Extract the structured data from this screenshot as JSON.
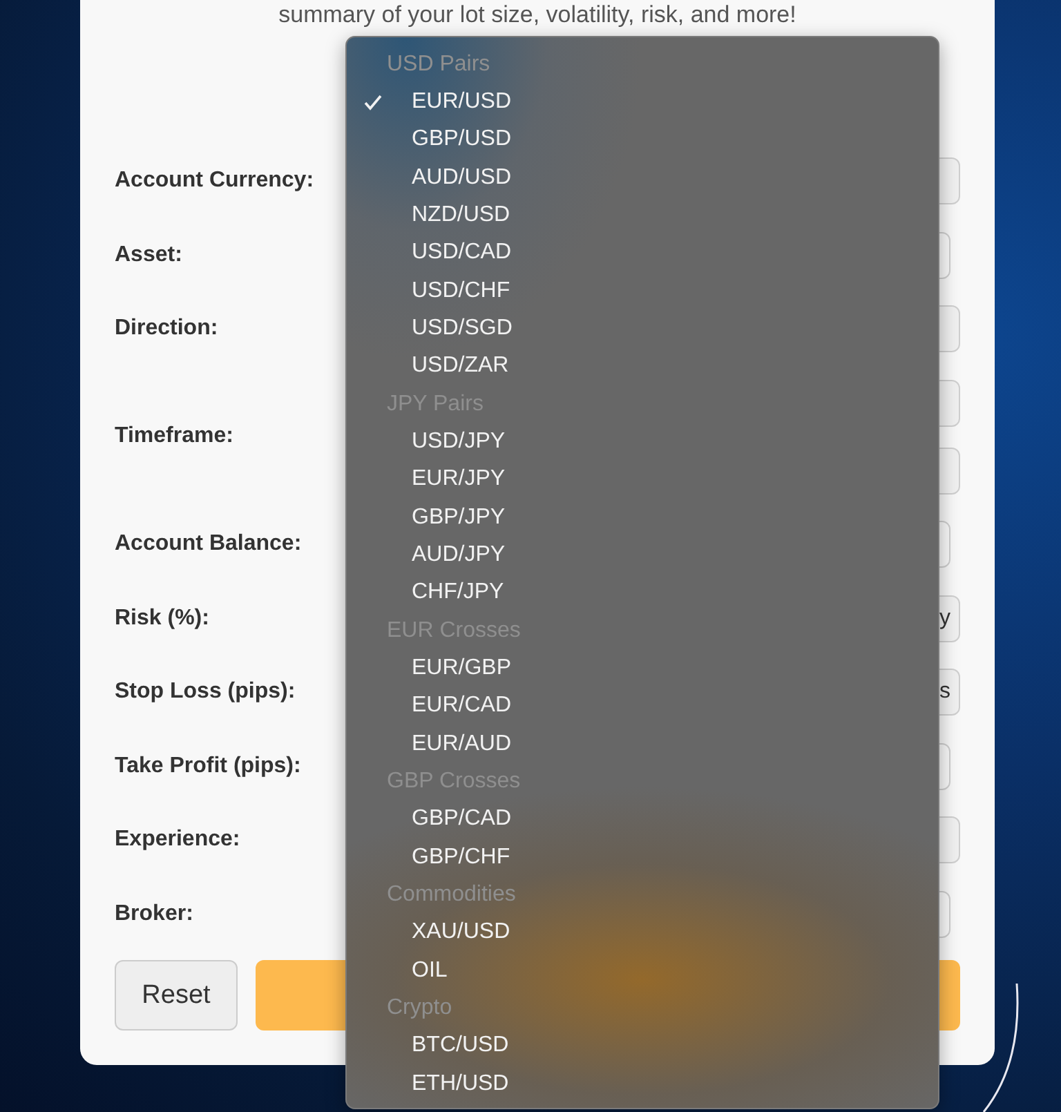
{
  "intro": "summary of your lot size, volatility, risk, and more!",
  "form": {
    "rows": [
      {
        "label": "Account Currency:",
        "fields": [
          {
            "kind": "select"
          }
        ]
      },
      {
        "label": "Asset:",
        "fields": [
          {
            "kind": "input"
          }
        ]
      },
      {
        "label": "Direction:",
        "fields": [
          {
            "kind": "select"
          }
        ]
      },
      {
        "label": "Timeframe:",
        "fields": [
          {
            "kind": "select"
          },
          {
            "kind": "select"
          }
        ]
      },
      {
        "label": "Account Balance:",
        "fields": [
          {
            "kind": "input"
          }
        ]
      },
      {
        "label": "Risk (%):",
        "fields": [
          {
            "kind": "select",
            "value": "y"
          }
        ]
      },
      {
        "label": "Stop Loss (pips):",
        "fields": [
          {
            "kind": "select",
            "value": "s"
          }
        ]
      },
      {
        "label": "Take Profit (pips):",
        "fields": [
          {
            "kind": "input"
          }
        ]
      },
      {
        "label": "Experience:",
        "fields": [
          {
            "kind": "select"
          }
        ]
      },
      {
        "label": "Broker:",
        "fields": [
          {
            "kind": "input"
          }
        ]
      }
    ]
  },
  "buttons": [
    {
      "kind": "secondary",
      "label": "Reset"
    },
    {
      "kind": "primary"
    }
  ],
  "dropdown": {
    "groups": [
      {
        "header": "USD Pairs",
        "options": [
          {
            "label": "EUR/USD",
            "selected": true
          },
          {
            "label": "GBP/USD",
            "selected": false
          },
          {
            "label": "AUD/USD",
            "selected": false
          },
          {
            "label": "NZD/USD",
            "selected": false
          },
          {
            "label": "USD/CAD",
            "selected": false
          },
          {
            "label": "USD/CHF",
            "selected": false
          },
          {
            "label": "USD/SGD",
            "selected": false
          },
          {
            "label": "USD/ZAR",
            "selected": false
          }
        ]
      },
      {
        "header": "JPY Pairs",
        "options": [
          {
            "label": "USD/JPY",
            "selected": false
          },
          {
            "label": "EUR/JPY",
            "selected": false
          },
          {
            "label": "GBP/JPY",
            "selected": false
          },
          {
            "label": "AUD/JPY",
            "selected": false
          },
          {
            "label": "CHF/JPY",
            "selected": false
          }
        ]
      },
      {
        "header": "EUR Crosses",
        "options": [
          {
            "label": "EUR/GBP",
            "selected": false
          },
          {
            "label": "EUR/CAD",
            "selected": false
          },
          {
            "label": "EUR/AUD",
            "selected": false
          }
        ]
      },
      {
        "header": "GBP Crosses",
        "options": [
          {
            "label": "GBP/CAD",
            "selected": false
          },
          {
            "label": "GBP/CHF",
            "selected": false
          }
        ]
      },
      {
        "header": "Commodities",
        "options": [
          {
            "label": "XAU/USD",
            "selected": false
          },
          {
            "label": "OIL",
            "selected": false
          }
        ]
      },
      {
        "header": "Crypto",
        "options": [
          {
            "label": "BTC/USD",
            "selected": false
          },
          {
            "label": "ETH/USD",
            "selected": false
          }
        ]
      }
    ]
  }
}
